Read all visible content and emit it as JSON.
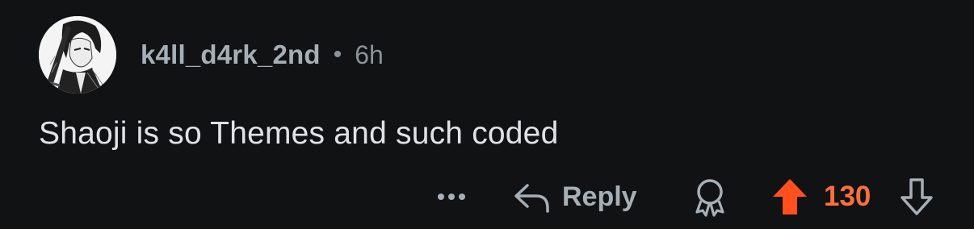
{
  "comment": {
    "username": "k4ll_d4rk_2nd",
    "separator": "•",
    "age": "6h",
    "text": "Shaoji is so Themes and such coded"
  },
  "actions": {
    "more_icon": "more-options-icon",
    "reply_label": "Reply",
    "reply_icon": "reply-arrow-icon",
    "award_icon": "award-icon",
    "upvote_icon": "upvote-arrow-icon",
    "score": "130",
    "downvote_icon": "downvote-arrow-icon"
  },
  "colors": {
    "background": "#111214",
    "username": "#a6afb6",
    "meta": "#8a9399",
    "body_text": "#dfe3e6",
    "upvote_active": "#ff4f1f",
    "score": "#ff6f3d"
  }
}
